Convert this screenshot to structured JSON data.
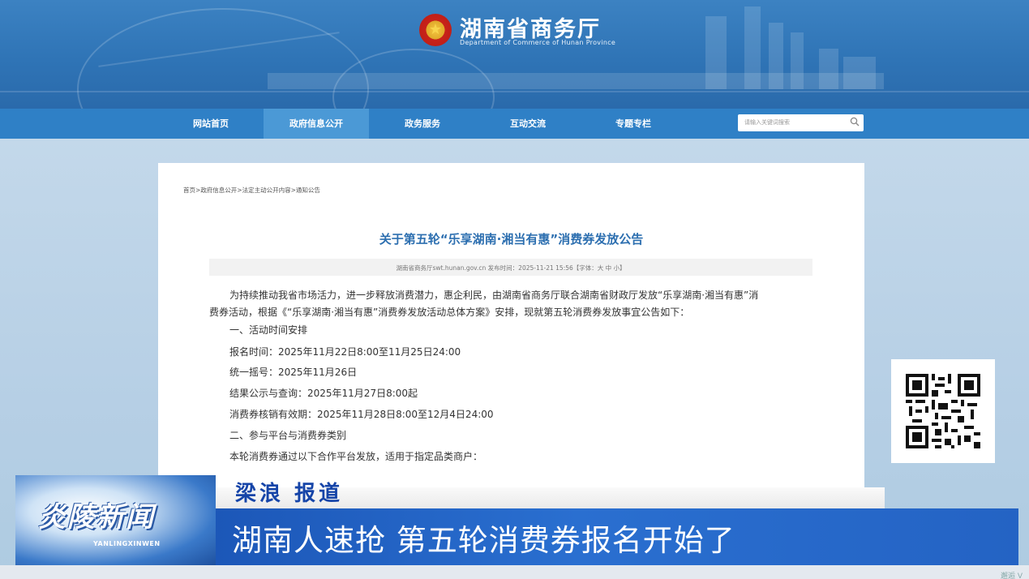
{
  "header": {
    "site_title": "湖南省商务厅",
    "site_subtitle": "Department of Commerce of Hunan Province",
    "emblem_glyph": "★"
  },
  "nav": {
    "items": [
      {
        "label": "网站首页",
        "active": false
      },
      {
        "label": "政府信息公开",
        "active": true
      },
      {
        "label": "政务服务",
        "active": false
      },
      {
        "label": "互动交流",
        "active": false
      },
      {
        "label": "专题专栏",
        "active": false
      }
    ],
    "search_placeholder": "请输入关键词搜索"
  },
  "article": {
    "breadcrumb": "首页>政府信息公开>法定主动公开内容>通知公告",
    "title": "关于第五轮“乐享湖南·湘当有惠”消费券发放公告",
    "meta": "湖南省商务厅swt.hunan.gov.cn 发布时间：2025-11-21 15:56【字体：大 中 小】",
    "paragraphs": [
      "为持续推动我省市场活力，进一步释放消费潜力，惠企利民，由湖南省商务厅联合湖南省财政厅发放“乐享湖南·湘当有惠”消",
      "费券活动，根据《“乐享湖南·湘当有惠”消费券发放活动总体方案》安排，现就第五轮消费券发放事宜公告如下：",
      "一、活动时间安排",
      "报名时间：2025年11月22日8:00至11月25日24:00",
      "统一摇号：2025年11月26日",
      "结果公示与查询：2025年11月27日8:00起",
      "消费券核销有效期：2025年11月28日8:00至12月4日24:00",
      "二、参与平台与消费券类别",
      "本轮消费券通过以下合作平台发放，适用于指定品类商户："
    ]
  },
  "lower_third": {
    "reporter": "梁浪  报道",
    "headline": "湖南人速抢  第五轮消费券报名开始了",
    "program_logo": "炎陵新闻",
    "program_logo_sub": "YANLINGXINWEN",
    "watermark": "邂逅 V"
  },
  "colors": {
    "banner": "#2f74b6",
    "nav": "#2f80c6",
    "nav_active": "#4b99d6",
    "title_blue": "#2d6fb0",
    "headline_bar": "#2463c4",
    "reporter": "#1544a8"
  }
}
